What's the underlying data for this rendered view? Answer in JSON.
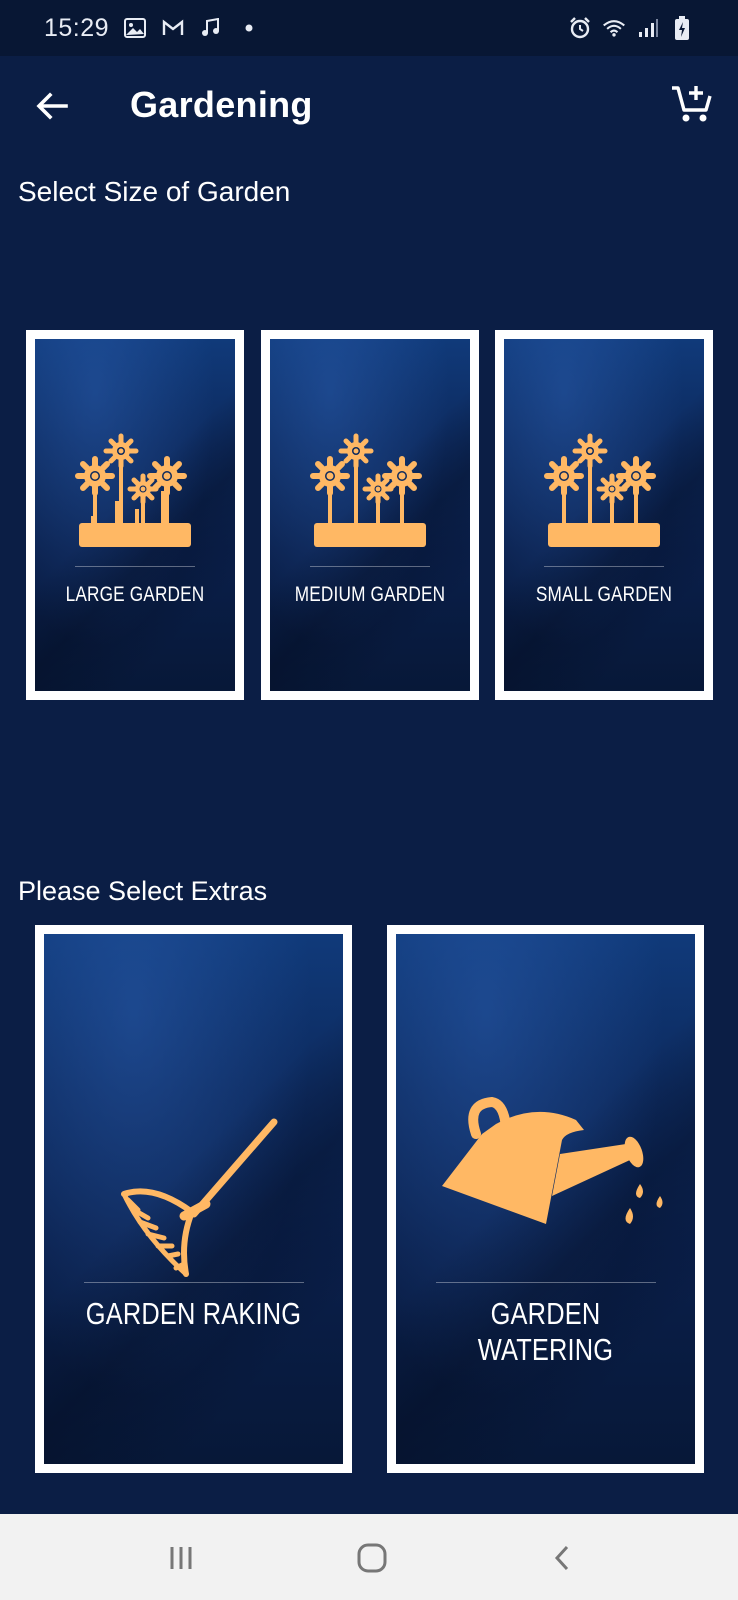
{
  "status_bar": {
    "time": "15:29",
    "left_icons": [
      "gallery-icon",
      "gmail-icon",
      "music-icon",
      "dot-icon"
    ],
    "right_icons": [
      "alarm-icon",
      "wifi-icon",
      "signal-icon",
      "battery-icon"
    ]
  },
  "app_bar": {
    "title": "Gardening",
    "back_icon": "arrow-left-icon",
    "cart_icon": "cart-add-icon"
  },
  "size_section": {
    "heading": "Select Size of Garden",
    "cards": [
      {
        "label": "LARGE GARDEN",
        "icon": "flower-planter-icon"
      },
      {
        "label": "MEDIUM GARDEN",
        "icon": "flower-planter-icon"
      },
      {
        "label": "SMALL GARDEN",
        "icon": "flower-planter-icon"
      }
    ]
  },
  "extras_section": {
    "heading": "Please Select Extras",
    "cards": [
      {
        "label": "GARDEN RAKING",
        "icon": "rake-icon"
      },
      {
        "label": "GARDEN WATERING",
        "icon": "watering-can-icon"
      }
    ]
  },
  "colors": {
    "background": "#0b1e45",
    "status_bar": "#081734",
    "icon_accent": "#ffb864",
    "card_border": "#ffffff",
    "nav_bar": "#f2f2f2"
  },
  "nav_bar": {
    "buttons": [
      "recent-apps-icon",
      "home-icon",
      "back-icon"
    ]
  }
}
